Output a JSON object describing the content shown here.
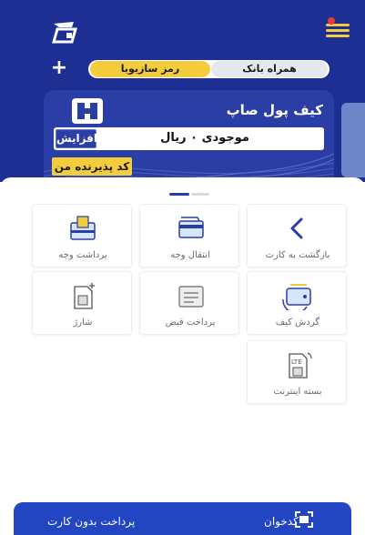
{
  "header": {
    "toggle_left": "رمز سازیوبا",
    "toggle_right": "همراه بانک",
    "plus_label": "+"
  },
  "card": {
    "title": "کیف پول صاپ",
    "balance": "موجودی ۰ ریال",
    "increase_label": "افزایش",
    "merchant_label": "کد پذیرنده من"
  },
  "tiles": [
    {
      "label": "بازگشت به کارت",
      "icon": "chevron-left-icon"
    },
    {
      "label": "انتقال وجه",
      "icon": "transfer-icon"
    },
    {
      "label": "برداشت وجه",
      "icon": "withdraw-icon"
    },
    {
      "label": "گردش کیف",
      "icon": "wallet-turnover-icon"
    },
    {
      "label": "پرداخت قبض",
      "icon": "bill-icon"
    },
    {
      "label": "شارژ",
      "icon": "sim-charge-icon"
    },
    {
      "label": "بسته اینترنت",
      "icon": "lte-sim-icon"
    }
  ],
  "bottom": {
    "no_card_label": "پرداخت بدون کارت",
    "scanner_label": "کدخوان"
  },
  "colors": {
    "primary": "#1d2f93",
    "accent": "#f4cd3d",
    "bottom_bar": "#2245c2"
  }
}
